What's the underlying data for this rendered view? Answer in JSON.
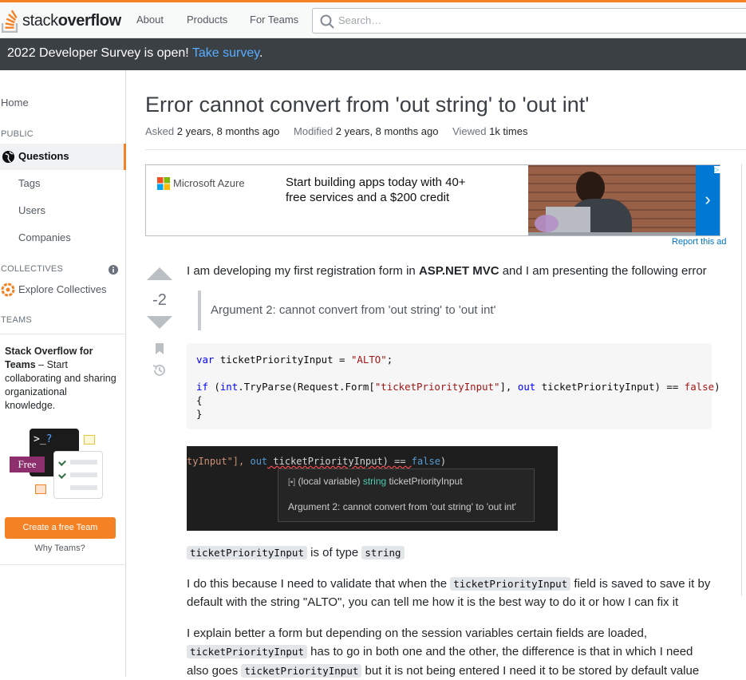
{
  "header": {
    "logo_regular": "stack",
    "logo_bold": "overflow",
    "nav": [
      "About",
      "Products",
      "For Teams"
    ],
    "search_placeholder": "Search…"
  },
  "banner": {
    "text": "2022 Developer Survey is open! ",
    "link": "Take survey",
    "suffix": "."
  },
  "sidebar": {
    "home": "Home",
    "public_heading": "PUBLIC",
    "questions": "Questions",
    "tags": "Tags",
    "users": "Users",
    "companies": "Companies",
    "collectives_heading": "COLLECTIVES",
    "explore_collectives": "Explore Collectives",
    "teams_heading": "TEAMS",
    "teams_title": "Stack Overflow for Teams",
    "teams_desc": " – Start collaborating and sharing organizational knowledge.",
    "free_badge": "Free",
    "create_team": "Create a free Team",
    "why_teams": "Why Teams?"
  },
  "question": {
    "title": "Error cannot convert from 'out string' to 'out int'",
    "asked_label": "Asked",
    "asked_value": "2 years, 8 months ago",
    "modified_label": "Modified",
    "modified_value": "2 years, 8 months ago",
    "viewed_label": "Viewed",
    "viewed_value": "1k times",
    "score": "-2"
  },
  "ad": {
    "brand": "Microsoft Azure",
    "line1": "Start building apps today with 40+",
    "line2": "free services and a $200 credit",
    "report": "Report this ad"
  },
  "body": {
    "p1_a": "I am developing my first registration form in ",
    "p1_b": "ASP.NET MVC",
    "p1_c": " and I am presenting the following error",
    "quote": "Argument 2: cannot convert from 'out string' to 'out int'",
    "code_line1_kw": "var",
    "code_line1_rest": " ticketPriorityInput = ",
    "code_line1_str": "\"ALTO\"",
    "code_line1_end": ";",
    "code_line2_kw": "if",
    "code_line2_a": " (",
    "code_line2_int": "int",
    "code_line2_b": ".TryParse(Request.Form[",
    "code_line2_str": "\"ticketPriorityInput\"",
    "code_line2_c": "], ",
    "code_line2_out": "out",
    "code_line2_d": " ticketPriorityInput) == ",
    "code_line2_false": "false",
    "code_line2_e": ")",
    "code_line3": "{",
    "code_line4": "}",
    "shot_line_a": "tyInput\"], ",
    "shot_line_out": "out",
    "shot_line_b": " ticketPriorityInput) == ",
    "shot_line_false": "false",
    "shot_line_c": ")",
    "tip_line1_a": "(local variable) ",
    "tip_line1_type": "string",
    "tip_line1_b": " ticketPriorityInput",
    "tip_line2": "Argument 2: cannot convert from 'out string' to 'out int'",
    "p2_code": "ticketPriorityInput",
    "p2_mid": " is of type ",
    "p2_type": "string",
    "p3_a": "I do this because I need to validate that when the ",
    "p3_code": "ticketPriorityInput",
    "p3_b": " field is saved to save it by",
    "p3_c": "default with the string \"ALTO\", you can tell me how it is the best way to do it or how I can fix it",
    "p4_a": "I explain better a form but depending on the session variables certain fields are loaded,",
    "p4_code1": "ticketPriorityInput",
    "p4_b": " has to go in both one and the other, the difference is that in which I need",
    "p4_c": "also goes ",
    "p4_code2": "ticketPriorityInput",
    "p4_d": " but it is not being entered I need it to be stored by default value"
  }
}
